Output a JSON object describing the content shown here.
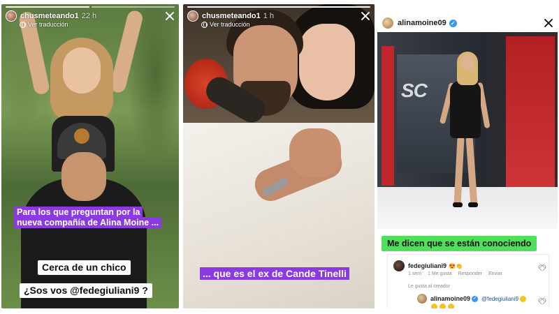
{
  "panels": [
    {
      "username": "chusmeteando1",
      "time": "22 h",
      "translate": "Ver traducción",
      "captions": {
        "line1": "Para los que preguntan por la",
        "line2": "nueva compañía de Alina Moine ...",
        "line3": "Cerca de un chico",
        "line4": "¿Sos vos @fedegiuliani9 ?"
      }
    },
    {
      "username": "chusmeteando1",
      "time": "1 h",
      "translate": "Ver traducción",
      "captions": {
        "line1": "... que es el ex de Cande Tinelli"
      }
    },
    {
      "username": "alinamoine09",
      "time": "",
      "verified": "✓",
      "set_logo": "SC",
      "title": "Me dicen que se están conociendo",
      "comment": {
        "user": "fedegiuliani9",
        "text": "😍👏",
        "meta": [
          "1 sem",
          "1 Me gusta",
          "Responder",
          "Enviar"
        ],
        "liked_by": "Le gusta al creador"
      },
      "reply": {
        "user": "alinamoine09",
        "verified": "✓",
        "text": "@fedegiuliani9",
        "emoji_count": 4
      }
    }
  ],
  "colors": {
    "caption_purple": "#8a3ae0",
    "title_green": "#4ee05a",
    "verified_blue": "#3897f0"
  }
}
